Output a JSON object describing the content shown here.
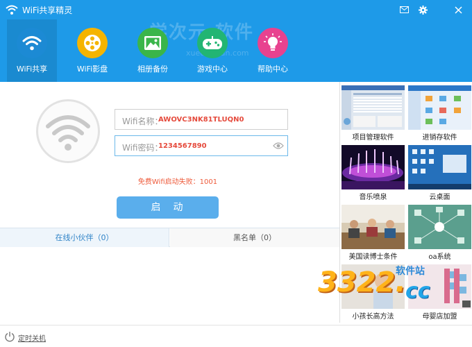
{
  "window": {
    "title": "WiFi共享精灵",
    "watermark": "学次元 软件",
    "watermark_sub": "xuechiyuan.com"
  },
  "nav": [
    {
      "label": "WiFi共享",
      "icon": "wifi-icon",
      "color": "#1e9ae8",
      "active": true
    },
    {
      "label": "WiFi影盘",
      "icon": "film-reel-icon",
      "color": "#f5b400",
      "active": false
    },
    {
      "label": "相册备份",
      "icon": "photo-icon",
      "color": "#3ab54a",
      "active": false
    },
    {
      "label": "游戏中心",
      "icon": "gamepad-icon",
      "color": "#22b573",
      "active": false
    },
    {
      "label": "帮助中心",
      "icon": "lightbulb-icon",
      "color": "#e8428f",
      "active": false
    }
  ],
  "wifi": {
    "name_label": "Wifi名称：",
    "name_value": "AWOVC3NK81TLUQN0",
    "password_label": "Wifi密码：",
    "password_value": "1234567890",
    "error": "免费Wifi启动失败：1001",
    "start_label": "启动"
  },
  "tabs": {
    "online": "在线小伙伴（0）",
    "blacklist": "黑名单（0）"
  },
  "ads": [
    {
      "label": "项目管理软件"
    },
    {
      "label": "进销存软件"
    },
    {
      "label": "音乐喷泉"
    },
    {
      "label": "云桌面"
    },
    {
      "label": "美国读博士条件"
    },
    {
      "label": "oa系统"
    },
    {
      "label": "小孩长高方法"
    },
    {
      "label": "母婴店加盟"
    }
  ],
  "corner_watermark": {
    "number": "3322.",
    "site": "软件站",
    "tld": "cc"
  },
  "footer": {
    "shutdown_label": "定时关机"
  },
  "colors": {
    "header": "#1e9ae8",
    "accent": "#5aaeec",
    "error": "#ee5a3a",
    "value_red": "#e54a3c"
  }
}
